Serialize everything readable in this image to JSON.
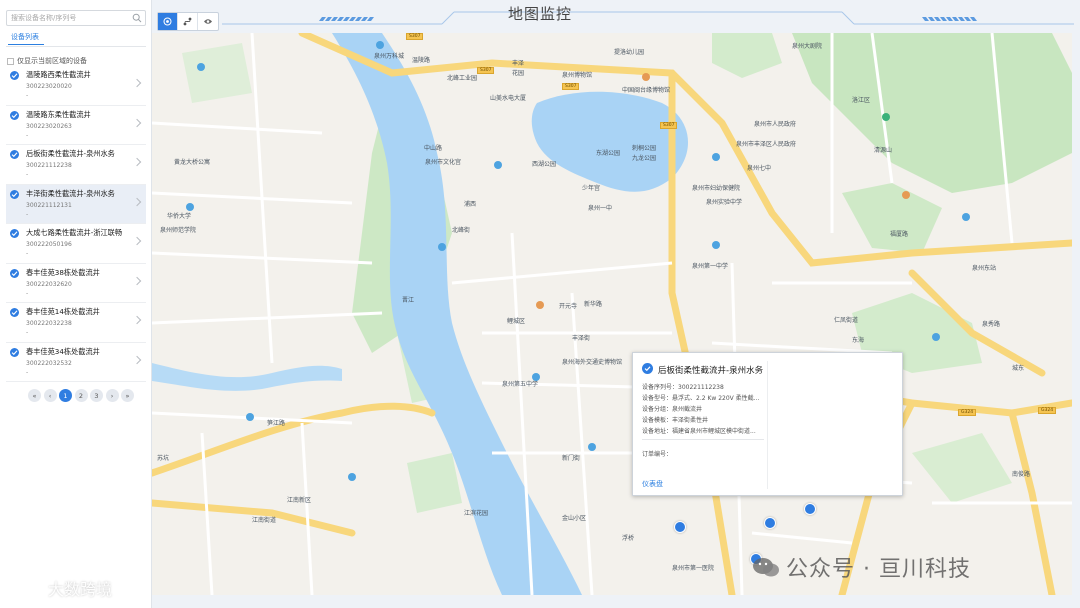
{
  "app": {
    "title": "地图监控"
  },
  "sidebar": {
    "search_placeholder": "搜索设备名称/序列号",
    "tab": "设备列表",
    "only_area": "仅显示当前区域的设备",
    "devices": [
      {
        "name": "温陵路西柔性截流井",
        "sn": "300223020020",
        "extra": "-"
      },
      {
        "name": "温陵路东柔性截流井",
        "sn": "300223020263",
        "extra": "-"
      },
      {
        "name": "后板街柔性截流井-泉州水务",
        "sn": "300221112238",
        "extra": "-"
      },
      {
        "name": "丰泽街柔性截流井-泉州水务",
        "sn": "300221112131",
        "extra": "-"
      },
      {
        "name": "大成七路柔性截流井-浙江联畅",
        "sn": "300222050196",
        "extra": "-"
      },
      {
        "name": "春丰佳苑38栋处截流井",
        "sn": "300222032620",
        "extra": "-"
      },
      {
        "name": "春丰佳苑14栋处截流井",
        "sn": "300222032238",
        "extra": "-"
      },
      {
        "name": "春丰佳苑34栋处截流井",
        "sn": "300222032532",
        "extra": "-"
      }
    ],
    "pager": [
      "«",
      "‹",
      "1",
      "2",
      "3",
      "›",
      "»"
    ]
  },
  "popup": {
    "title": "后板街柔性截流井-泉州水务",
    "rows": [
      "设备序列号：300221112238",
      "设备型号：悬浮式、2.2 Kw 220V 柔性截...",
      "设备分组：泉州截流井",
      "设备模板：丰泽街柔性井",
      "设备地址：福建省泉州市鲤城区模中街道..."
    ],
    "order": "订单编号：",
    "dashboard": "仪表盘"
  },
  "map_labels": [
    "泉州万科城",
    "北峰工业园",
    "丰泽",
    "花园",
    "泉州博物馆",
    "提洛幼儿园",
    "山美水电大厦",
    "泉州市人民政府",
    "泉州第一中学",
    "黄龙大桥公寓",
    "洛江区",
    "东湖公园",
    "西湖公园",
    "泉州一中",
    "中山路",
    "鲤城区",
    "泉州市文化宫",
    "金山小区",
    "江南新区",
    "江滨花园",
    "刺桐公园",
    "九龙公园",
    "华侨大学",
    "泉州市第一医院",
    "苏坑",
    "笋江路",
    "温陵路",
    "丰泽街",
    "泉秀路",
    "浦西",
    "新门街",
    "东海",
    "新华路",
    "南俊路",
    "福厦路",
    "晋江",
    "城东",
    "北峰街",
    "泉州市妇幼保健院",
    "清源山",
    "泉州师范学院",
    "仁凤街道",
    "泉州第五中学",
    "泉州海外交通史博物馆",
    "开元寺",
    "泉州东站",
    "泉州市丰泽区人民政府",
    "泉州实验中学",
    "泉州七中",
    "少年宫",
    "浮桥",
    "中国闽台缘博物馆",
    "泉州大剧院",
    "江南街道"
  ],
  "watermark_left": "大数跨境",
  "watermark_right": "公众号 · 亘川科技",
  "colors": {
    "accent": "#2f7de1",
    "river": "#a9d3f5",
    "park": "#c6e7c1",
    "road": "#ffffff",
    "main_road": "#f8d77c"
  },
  "icons": [
    "search-icon",
    "check-icon",
    "chevron-right-icon",
    "locate-icon",
    "route-icon",
    "eye-icon",
    "map-pin-icon"
  ]
}
